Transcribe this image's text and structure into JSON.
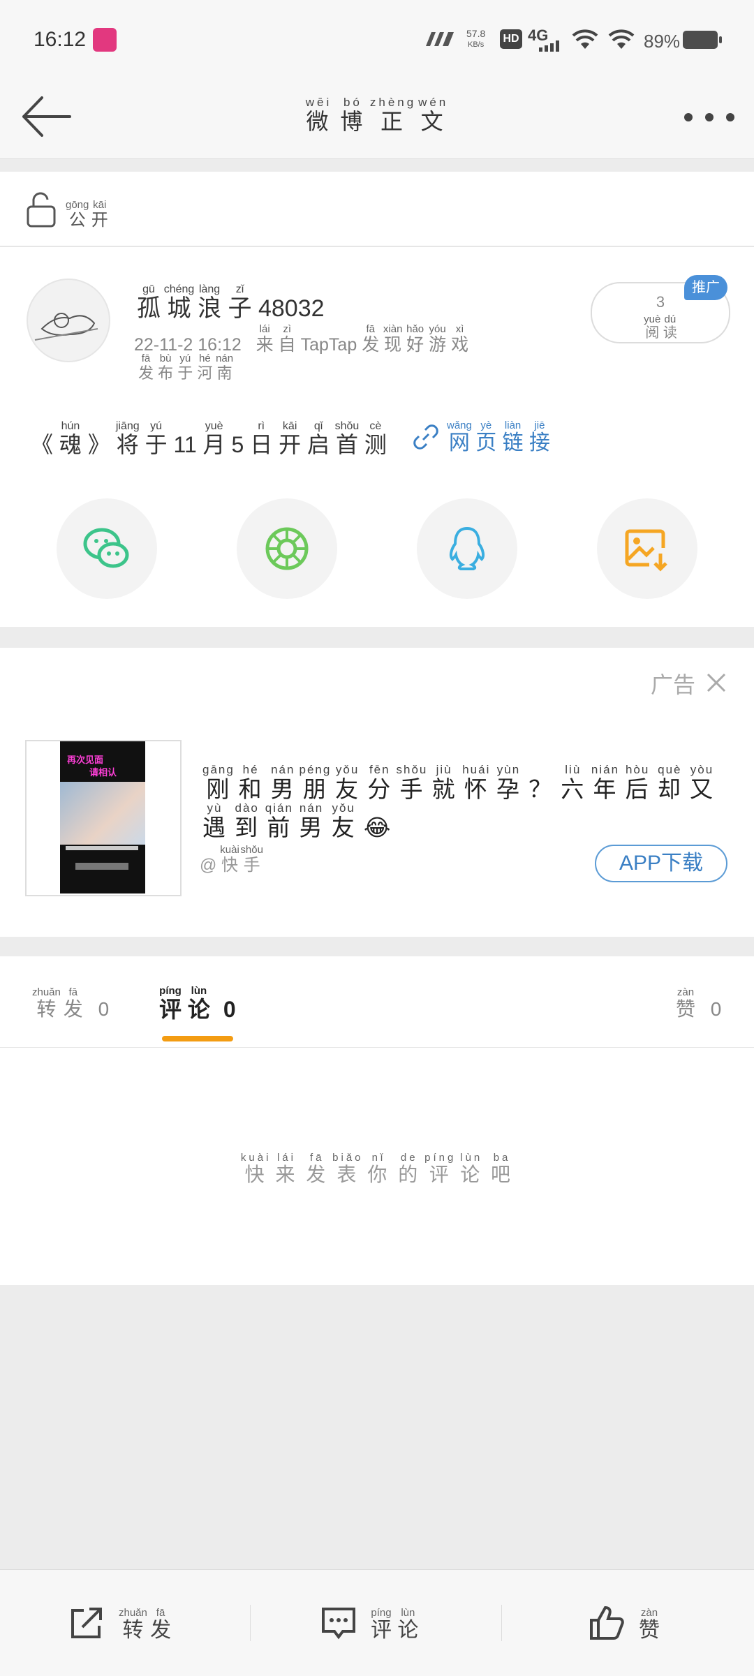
{
  "status_bar": {
    "time": "16:12",
    "speed_value": "57.8",
    "speed_unit": "KB/s",
    "hd": "HD",
    "network": "4G",
    "battery_pct": "89%"
  },
  "nav": {
    "title": [
      {
        "hanzi": "微",
        "pinyin": "wēi"
      },
      {
        "hanzi": "博",
        "pinyin": "bó"
      },
      {
        "hanzi": "正",
        "pinyin": "zhèng"
      },
      {
        "hanzi": "文",
        "pinyin": "wén"
      }
    ]
  },
  "visibility": {
    "label": [
      {
        "hanzi": "公",
        "pinyin": "gōng"
      },
      {
        "hanzi": "开",
        "pinyin": "kāi"
      }
    ]
  },
  "post": {
    "author": [
      {
        "hanzi": "孤",
        "pinyin": "gū"
      },
      {
        "hanzi": "城",
        "pinyin": "chéng"
      },
      {
        "hanzi": "浪",
        "pinyin": "làng"
      },
      {
        "hanzi": "子",
        "pinyin": "zǐ"
      },
      {
        "hanzi": "48032",
        "pinyin": ""
      }
    ],
    "time": "22-11-2 16:12",
    "source": [
      {
        "hanzi": "来",
        "pinyin": "lái"
      },
      {
        "hanzi": "自",
        "pinyin": "zì"
      },
      {
        "hanzi": "TapTap",
        "pinyin": ""
      },
      {
        "hanzi": "发",
        "pinyin": "fā"
      },
      {
        "hanzi": "现",
        "pinyin": "xiàn"
      },
      {
        "hanzi": "好",
        "pinyin": "hǎo"
      },
      {
        "hanzi": "游",
        "pinyin": "yóu"
      },
      {
        "hanzi": "戏",
        "pinyin": "xì"
      }
    ],
    "location": [
      {
        "hanzi": "发",
        "pinyin": "fā"
      },
      {
        "hanzi": "布",
        "pinyin": "bù"
      },
      {
        "hanzi": "于",
        "pinyin": "yú"
      },
      {
        "hanzi": "河",
        "pinyin": "hé"
      },
      {
        "hanzi": "南",
        "pinyin": "nán"
      }
    ],
    "read_count": "3",
    "read_label": [
      {
        "hanzi": "阅",
        "pinyin": "yuè"
      },
      {
        "hanzi": "读",
        "pinyin": "dú"
      }
    ],
    "promo_badge": "推广",
    "text": [
      {
        "hanzi": "《",
        "pinyin": ""
      },
      {
        "hanzi": "魂",
        "pinyin": "hún"
      },
      {
        "hanzi": "》",
        "pinyin": ""
      },
      {
        "hanzi": "将",
        "pinyin": "jiāng"
      },
      {
        "hanzi": "于",
        "pinyin": "yú"
      },
      {
        "hanzi": "11",
        "pinyin": ""
      },
      {
        "hanzi": "月",
        "pinyin": "yuè"
      },
      {
        "hanzi": "5",
        "pinyin": ""
      },
      {
        "hanzi": "日",
        "pinyin": "rì"
      },
      {
        "hanzi": "开",
        "pinyin": "kāi"
      },
      {
        "hanzi": "启",
        "pinyin": "qǐ"
      },
      {
        "hanzi": "首",
        "pinyin": "shǒu"
      },
      {
        "hanzi": "测",
        "pinyin": "cè"
      }
    ],
    "link": [
      {
        "hanzi": "网",
        "pinyin": "wǎng"
      },
      {
        "hanzi": "页",
        "pinyin": "yè"
      },
      {
        "hanzi": "链",
        "pinyin": "liàn"
      },
      {
        "hanzi": "接",
        "pinyin": "jiē"
      }
    ],
    "share_icons": [
      "wechat-icon",
      "moments-icon",
      "qq-icon",
      "save-image-icon"
    ],
    "colors": {
      "wechat": "#3cc48a",
      "moments": "#6cc95a",
      "qq": "#3aaee0",
      "save": "#f5a623",
      "link": "#3a7fc4"
    }
  },
  "ad": {
    "label": "广告",
    "thumb_text_1": "再次见面",
    "thumb_text_2": "请相认",
    "title": [
      {
        "hanzi": "刚",
        "pinyin": "gāng"
      },
      {
        "hanzi": "和",
        "pinyin": "hé"
      },
      {
        "hanzi": "男",
        "pinyin": "nán"
      },
      {
        "hanzi": "朋",
        "pinyin": "péng"
      },
      {
        "hanzi": "友",
        "pinyin": "yǒu"
      },
      {
        "hanzi": "分",
        "pinyin": "fēn"
      },
      {
        "hanzi": "手",
        "pinyin": "shǒu"
      },
      {
        "hanzi": "就",
        "pinyin": "jiù"
      },
      {
        "hanzi": "怀",
        "pinyin": "huái"
      },
      {
        "hanzi": "孕",
        "pinyin": "yùn"
      },
      {
        "hanzi": "？",
        "pinyin": ""
      },
      {
        "hanzi": "六",
        "pinyin": "liù"
      },
      {
        "hanzi": "年",
        "pinyin": "nián"
      },
      {
        "hanzi": "后",
        "pinyin": "hòu"
      },
      {
        "hanzi": "却",
        "pinyin": "què"
      },
      {
        "hanzi": "又",
        "pinyin": "yòu"
      },
      {
        "hanzi": "遇",
        "pinyin": "yù"
      },
      {
        "hanzi": "到",
        "pinyin": "dào"
      },
      {
        "hanzi": "前",
        "pinyin": "qián"
      },
      {
        "hanzi": "男",
        "pinyin": "nán"
      },
      {
        "hanzi": "友",
        "pinyin": "yǒu"
      },
      {
        "hanzi": "😂",
        "pinyin": ""
      }
    ],
    "source": [
      {
        "hanzi": "@",
        "pinyin": ""
      },
      {
        "hanzi": "快",
        "pinyin": "kuài"
      },
      {
        "hanzi": "手",
        "pinyin": "shǒu"
      }
    ],
    "download_label": "APP下载"
  },
  "tabs": {
    "repost": [
      {
        "hanzi": "转",
        "pinyin": "zhuǎn"
      },
      {
        "hanzi": "发",
        "pinyin": "fā"
      }
    ],
    "repost_count": "0",
    "comment": [
      {
        "hanzi": "评",
        "pinyin": "píng"
      },
      {
        "hanzi": "论",
        "pinyin": "lùn"
      }
    ],
    "comment_count": "0",
    "like": [
      {
        "hanzi": "赞",
        "pinyin": "zàn"
      }
    ],
    "like_count": "0",
    "accent": "#f39c12"
  },
  "comments": {
    "empty_hint": [
      {
        "hanzi": "快",
        "pinyin": "kuài"
      },
      {
        "hanzi": "来",
        "pinyin": "lái"
      },
      {
        "hanzi": "发",
        "pinyin": "fā"
      },
      {
        "hanzi": "表",
        "pinyin": "biǎo"
      },
      {
        "hanzi": "你",
        "pinyin": "nǐ"
      },
      {
        "hanzi": "的",
        "pinyin": "de"
      },
      {
        "hanzi": "评",
        "pinyin": "píng"
      },
      {
        "hanzi": "论",
        "pinyin": "lùn"
      },
      {
        "hanzi": "吧",
        "pinyin": "ba"
      }
    ]
  },
  "bottom_bar": {
    "repost": [
      {
        "hanzi": "转",
        "pinyin": "zhuǎn"
      },
      {
        "hanzi": "发",
        "pinyin": "fā"
      }
    ],
    "comment": [
      {
        "hanzi": "评",
        "pinyin": "píng"
      },
      {
        "hanzi": "论",
        "pinyin": "lùn"
      }
    ],
    "like": [
      {
        "hanzi": "赞",
        "pinyin": "zàn"
      }
    ]
  }
}
